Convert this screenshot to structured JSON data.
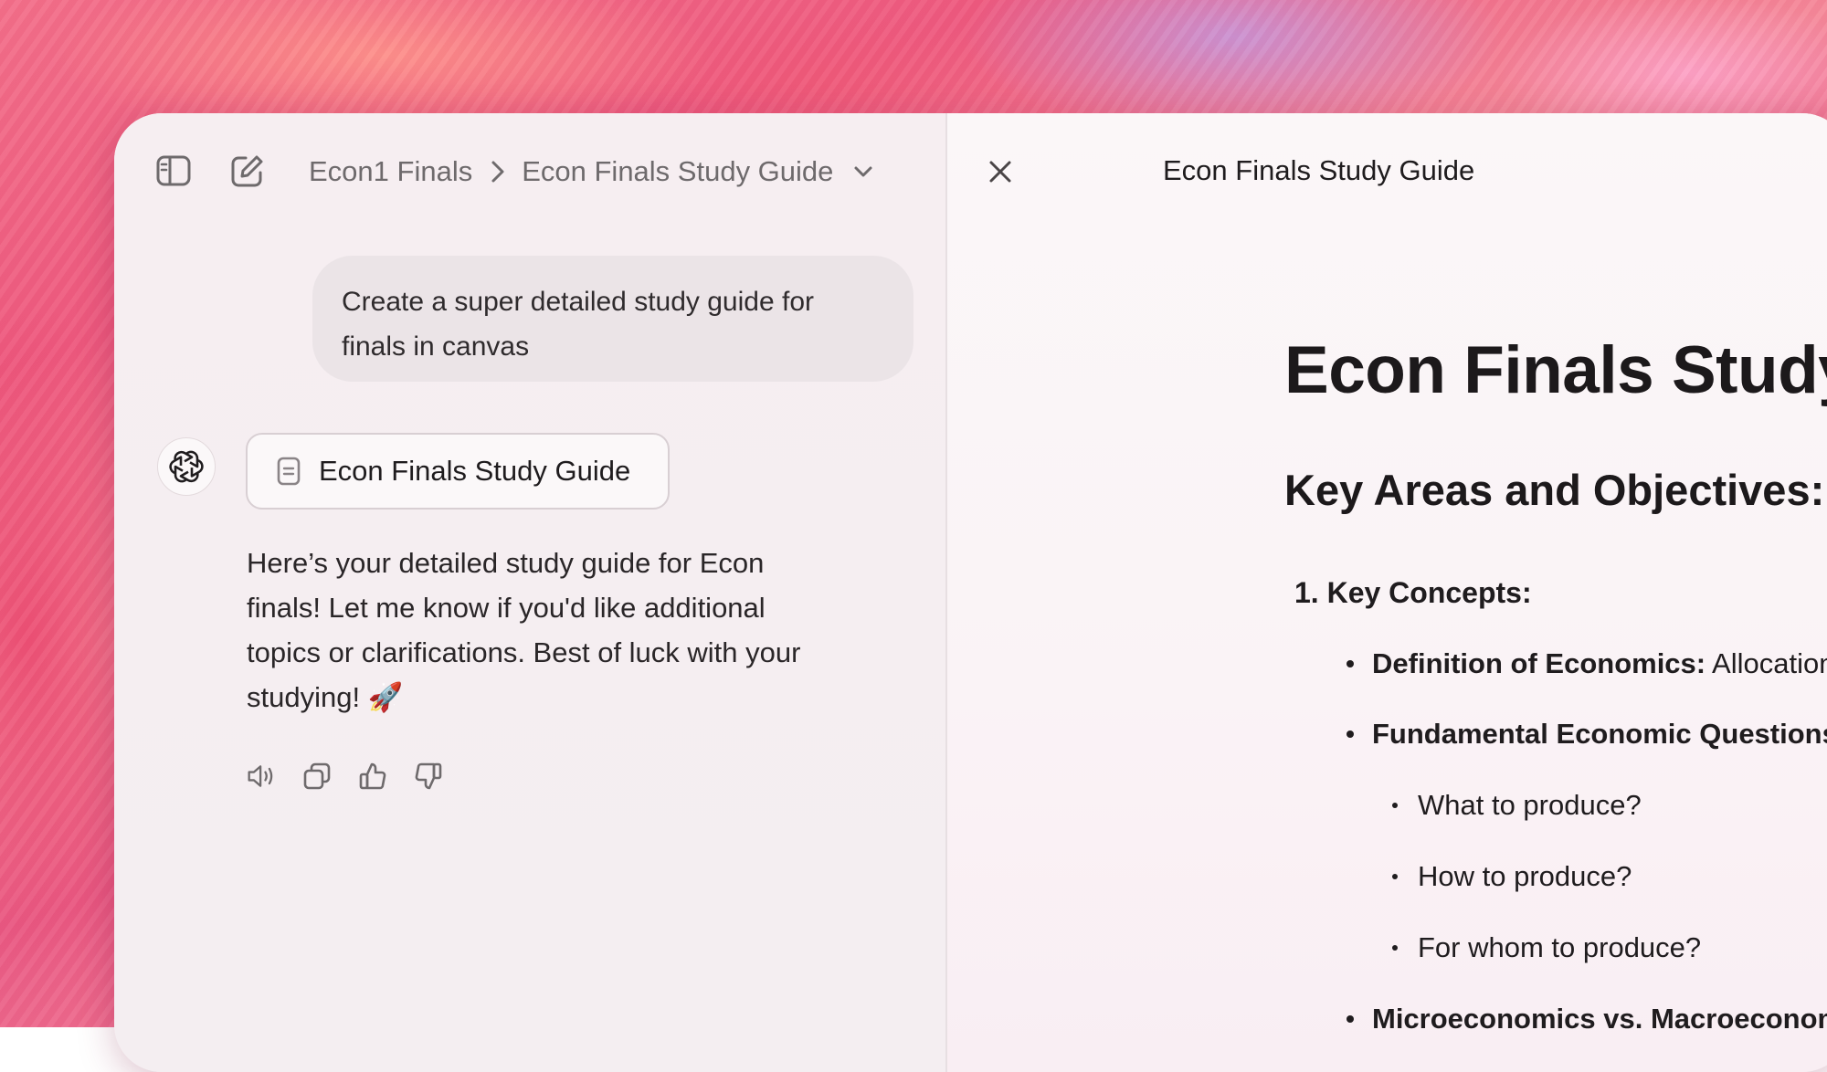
{
  "header": {
    "crumb_project": "Econ1 Finals",
    "crumb_chat": "Econ Finals Study Guide"
  },
  "conversation": {
    "user_message": "Create a super detailed study guide for finals in canvas",
    "doc_chip_label": "Econ Finals Study Guide",
    "assistant_reply": "Here’s your detailed study guide for Econ finals! Let me know if you'd like additional topics or clarifications. Best of luck with your studying! 🚀"
  },
  "canvas": {
    "title": "Econ Finals Study Guide",
    "heading": "Econ Finals Study Gui",
    "subheading": "Key Areas and Objectives:",
    "section_1": "1. Key Concepts:",
    "item_1_label": "Definition of Economics:",
    "item_1_text": " Allocation of scar",
    "item_2_label": "Fundamental Economic Questions:",
    "sub_1": "What to produce?",
    "sub_2": "How to produce?",
    "sub_3": "For whom to produce?",
    "item_3_label": "Microeconomics vs. Macroeconomics:"
  },
  "icons": {
    "sidebar_toggle": "sidebar-icon",
    "new_chat": "compose-icon",
    "breadcrumb_separator": "chevron-right-icon",
    "breadcrumb_menu": "chevron-down-icon",
    "assistant_avatar": "openai-logo-icon",
    "document": "document-icon",
    "read_aloud": "speaker-icon",
    "copy": "copy-icon",
    "thumbs_up": "thumbs-up-icon",
    "thumbs_down": "thumbs-down-icon",
    "close_canvas": "close-icon"
  }
}
